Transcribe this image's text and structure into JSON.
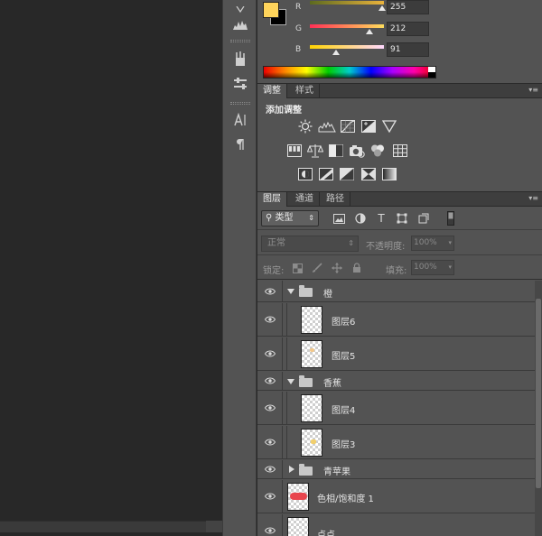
{
  "color_panel": {
    "foreground_color": "#ffd45b",
    "background_color": "#000000",
    "channels": [
      {
        "label": "R",
        "value": "255",
        "fraction": 1.0
      },
      {
        "label": "G",
        "value": "212",
        "fraction": 0.83
      },
      {
        "label": "B",
        "value": "91",
        "fraction": 0.36
      }
    ]
  },
  "adjustments_panel": {
    "tabs": [
      "调整",
      "样式"
    ],
    "title": "添加调整"
  },
  "layers_panel": {
    "tabs": [
      "图层",
      "通道",
      "路径"
    ],
    "kind_filter": "类型",
    "blend_mode": "正常",
    "opacity_label": "不透明度:",
    "opacity_value": "100%",
    "lock_label": "锁定:",
    "fill_label": "填充:",
    "fill_value": "100%",
    "layers": [
      {
        "kind": "group",
        "name": "橙",
        "expanded": true
      },
      {
        "kind": "layer",
        "name": "图层6",
        "nested": true
      },
      {
        "kind": "layer",
        "name": "图层5",
        "nested": true
      },
      {
        "kind": "group",
        "name": "香蕉",
        "expanded": true
      },
      {
        "kind": "layer",
        "name": "图层4",
        "nested": true
      },
      {
        "kind": "layer",
        "name": "图层3",
        "nested": true
      },
      {
        "kind": "group",
        "name": "青苹果",
        "expanded": false
      },
      {
        "kind": "adjustment",
        "name": "色相/饱和度 1"
      },
      {
        "kind": "layer",
        "name": "点点"
      }
    ]
  }
}
